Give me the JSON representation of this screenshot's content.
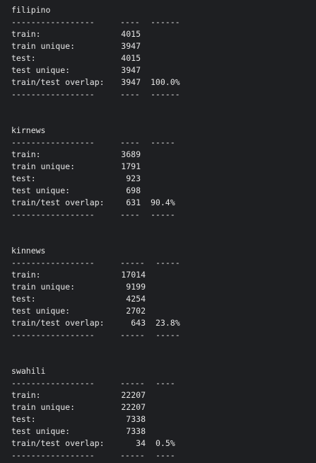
{
  "blocks": [
    {
      "name": "filipino",
      "sep": [
        "-----------------",
        "----",
        "------"
      ],
      "rows": [
        {
          "label": "train:",
          "value": "4015",
          "pct": ""
        },
        {
          "label": "train unique:",
          "value": "3947",
          "pct": ""
        },
        {
          "label": "test:",
          "value": "4015",
          "pct": ""
        },
        {
          "label": "test unique:",
          "value": "3947",
          "pct": ""
        },
        {
          "label": "train/test overlap:",
          "value": "3947",
          "pct": "100.0%"
        }
      ]
    },
    {
      "name": "kirnews",
      "sep": [
        "-----------------",
        "----",
        "-----"
      ],
      "rows": [
        {
          "label": "train:",
          "value": "3689",
          "pct": ""
        },
        {
          "label": "train unique:",
          "value": "1791",
          "pct": ""
        },
        {
          "label": "test:",
          "value": "923",
          "pct": ""
        },
        {
          "label": "test unique:",
          "value": "698",
          "pct": ""
        },
        {
          "label": "train/test overlap:",
          "value": "631",
          "pct": "90.4%"
        }
      ]
    },
    {
      "name": "kinnews",
      "sep": [
        "-----------------",
        "-----",
        "-----"
      ],
      "rows": [
        {
          "label": "train:",
          "value": "17014",
          "pct": ""
        },
        {
          "label": "train unique:",
          "value": "9199",
          "pct": ""
        },
        {
          "label": "test:",
          "value": "4254",
          "pct": ""
        },
        {
          "label": "test unique:",
          "value": "2702",
          "pct": ""
        },
        {
          "label": "train/test overlap:",
          "value": "643",
          "pct": "23.8%"
        }
      ]
    },
    {
      "name": "swahili",
      "sep": [
        "-----------------",
        "-----",
        "----"
      ],
      "rows": [
        {
          "label": "train:",
          "value": "22207",
          "pct": ""
        },
        {
          "label": "train unique:",
          "value": "22207",
          "pct": ""
        },
        {
          "label": "test:",
          "value": "7338",
          "pct": ""
        },
        {
          "label": "test unique:",
          "value": "7338",
          "pct": ""
        },
        {
          "label": "train/test overlap:",
          "value": "34",
          "pct": "0.5%"
        }
      ]
    }
  ]
}
